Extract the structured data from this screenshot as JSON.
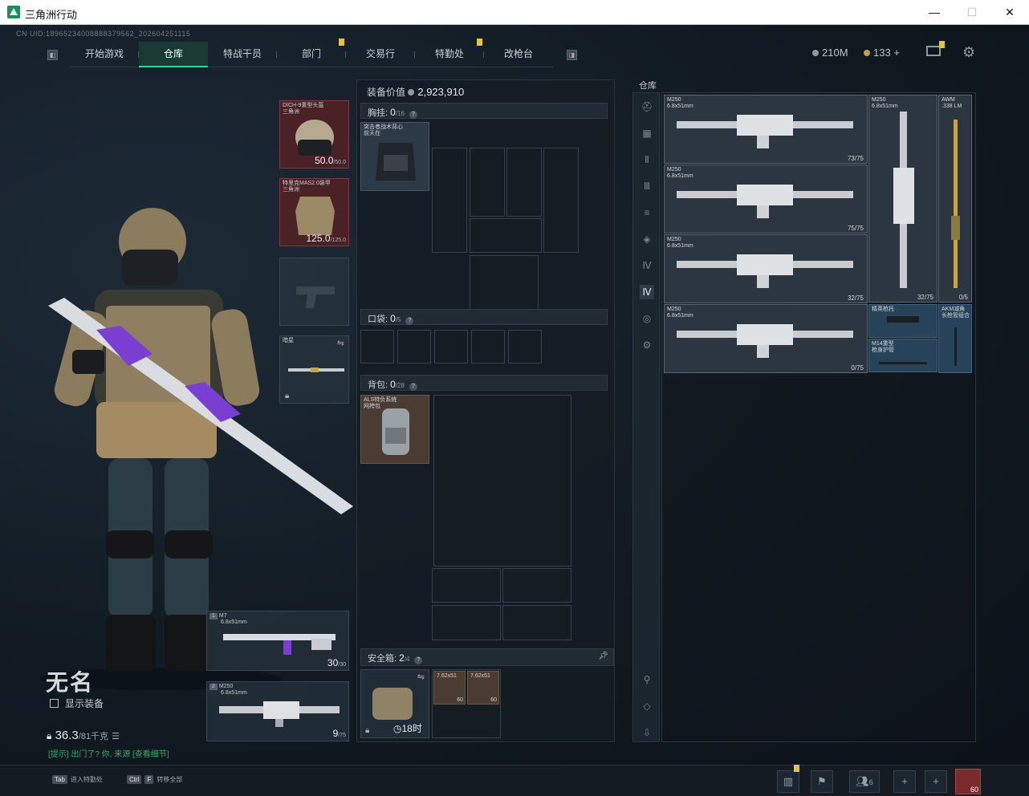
{
  "window": {
    "title": "三角洲行动",
    "minimize": "—",
    "maximize": "☐",
    "close": "✕"
  },
  "uid": "CN UID:18965234008888379562_202604251115",
  "nav": {
    "left_icon": "◧",
    "tabs": [
      "开始游戏",
      "仓库",
      "特战干员",
      "部门",
      "交易行",
      "特勤处",
      "改枪台"
    ],
    "active_tab": "仓库",
    "right_icon": "◨"
  },
  "currency": {
    "silver": "210M",
    "gold": "133",
    "gold_add": "+"
  },
  "character": {
    "name": "无名",
    "show_equipment_label": "显示装备",
    "weight": "36.3",
    "weight_max": "/81千克",
    "hint": "[提示] 出门了? 你, 来源 [查看细节]"
  },
  "gear": {
    "helmet": {
      "name": "DICH-9重型头盔",
      "sub": "三角洲",
      "durability": "50.0",
      "durability_max": "/50.0"
    },
    "armor": {
      "name": "特里克MAS2.0装甲",
      "sub": "三角洲",
      "durability": "125.0",
      "durability_max": "/125.0"
    },
    "melee": {
      "name": "暗星"
    },
    "primary": {
      "index": "1",
      "name": "M7",
      "caliber": "6.8x51mm",
      "ammo": "30",
      "ammo_max": "/30"
    },
    "secondary": {
      "index": "2",
      "name": "M250",
      "caliber": "6.8x51mm",
      "ammo": "9",
      "ammo_max": "/75"
    }
  },
  "loadout": {
    "value_label": "装备价值",
    "value": "2,923,910",
    "chest": {
      "label": "胸挂:",
      "count": "0",
      "max": "/16",
      "item_name": "突击者战术背心",
      "item_sub": "前天在"
    },
    "pocket": {
      "label": "口袋:",
      "count": "0",
      "max": "/5"
    },
    "backpack": {
      "label": "背包:",
      "count": "0",
      "max": "/28",
      "item_name": "ALS特负系统",
      "item_sub": "网挎包"
    },
    "safebox": {
      "label": "安全箱:",
      "count": "2",
      "max": "/4",
      "timer": "18时",
      "ammo1": "60",
      "ammo2": "60",
      "ammo_label": "7.62x51"
    }
  },
  "warehouse": {
    "title": "仓库",
    "side_icons": [
      "helmet-icon",
      "armor-icon",
      "rifle-icon",
      "smg-icon",
      "shotgun-icon",
      "pistol-icon",
      "rifle2-icon",
      "sniper-icon",
      "ammo-icon",
      "settings-icon"
    ],
    "side_glyphs": [
      "⛑",
      "▦",
      "Ⅱ",
      "Ⅲ",
      "≡",
      "◈",
      "Ⅳ",
      "Ⅳ",
      "◎",
      "⚙"
    ],
    "bottom_icons": [
      "⚲",
      "◇",
      "⇩"
    ],
    "items": [
      {
        "name": "M250",
        "cal": "6.8x51mm",
        "ammo": "73/75"
      },
      {
        "name": "M250",
        "cal": "6.8x51mm",
        "ammo": "75/75"
      },
      {
        "name": "M250",
        "cal": "6.8x51mm",
        "ammo": "32/75"
      },
      {
        "name": "M250",
        "cal": "6.8x51mm",
        "ammo": "0/75"
      },
      {
        "name": "M250",
        "cal": "6.8x51mm",
        "ammo": "32/75"
      },
      {
        "name": "AWM",
        "cal": ".338 LM",
        "ammo": "0/5"
      },
      {
        "name": "精英枪托",
        "cal": "",
        "ammo": ""
      },
      {
        "name": "AKM减角",
        "cal": "长枪管组合",
        "ammo": ""
      },
      {
        "name": "M14重型",
        "cal": "枪身护管",
        "ammo": ""
      }
    ]
  },
  "bottombar": {
    "key1": "Tab",
    "key1_label": "进入特勤处",
    "key2a": "Ctrl",
    "key2b": "F",
    "key2_label": "转移全部",
    "players": "6",
    "avatar_level": "60"
  }
}
